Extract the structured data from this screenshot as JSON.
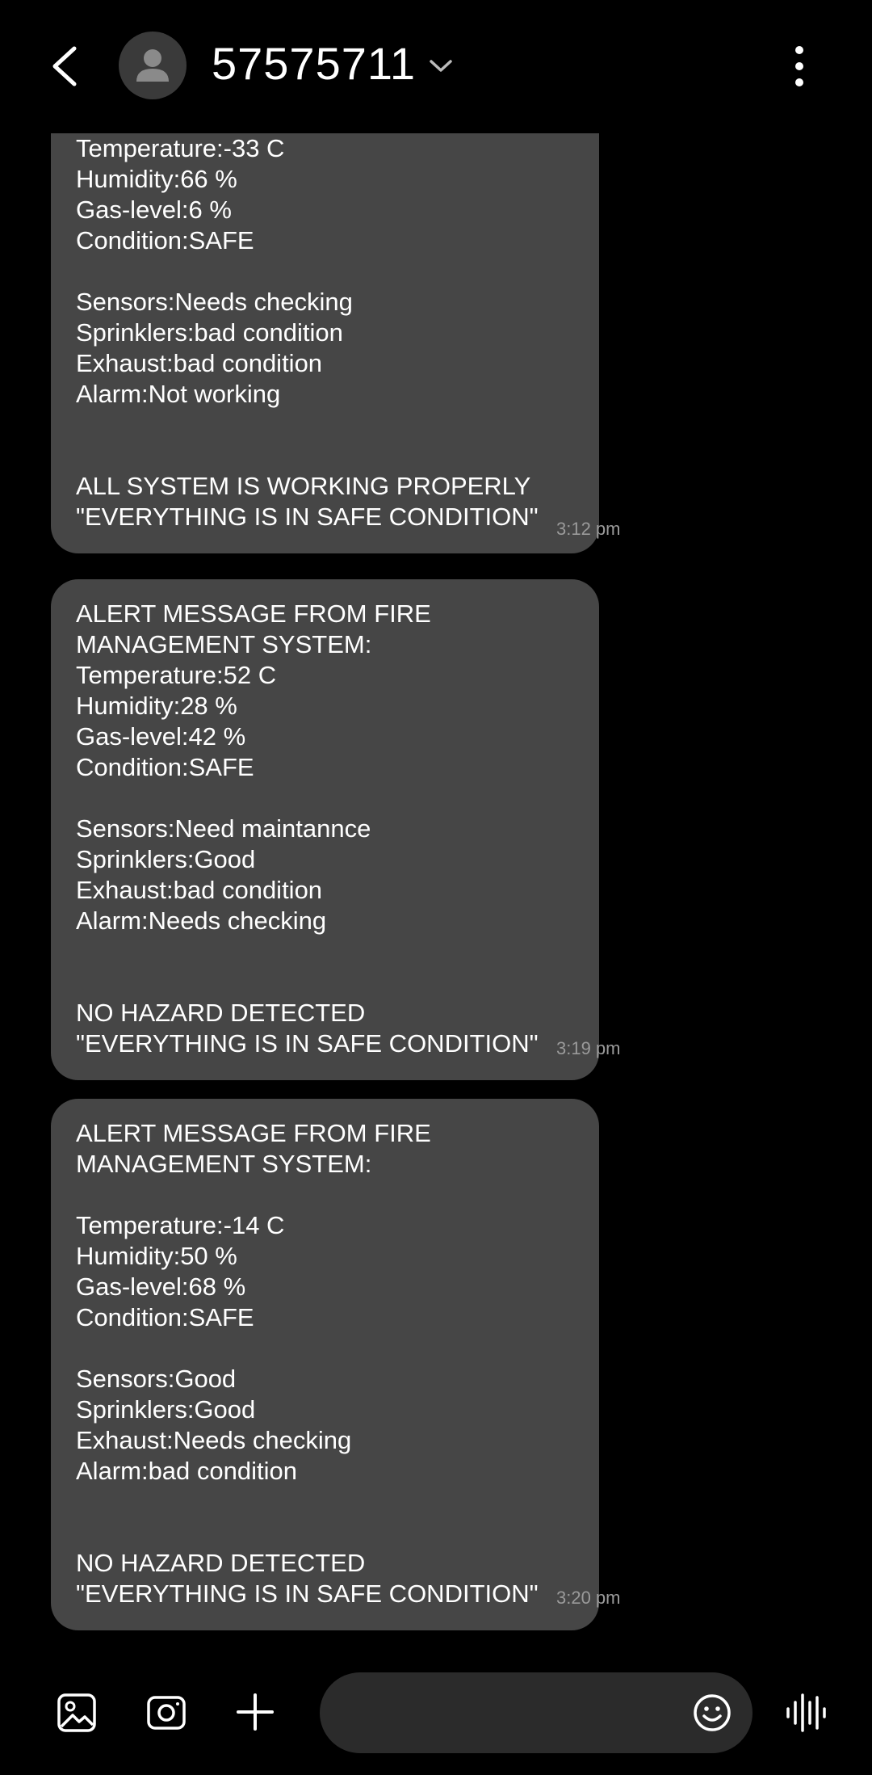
{
  "header": {
    "title": "57575711",
    "icons": {
      "back": "back-arrow-icon",
      "avatar": "contact-avatar",
      "dropdown": "chevron-down-icon",
      "more": "more-vertical-icon"
    }
  },
  "messages": [
    {
      "lines": [
        "Temperature:-33 C",
        "Humidity:66 %",
        "Gas-level:6 %",
        "Condition:SAFE",
        "",
        "Sensors:Needs checking",
        "Sprinklers:bad condition",
        "Exhaust:bad condition",
        "Alarm:Not working",
        "",
        "",
        "ALL SYSTEM IS WORKING PROPERLY",
        "\"EVERYTHING IS IN SAFE CONDITION\""
      ],
      "time": "3:12 pm"
    },
    {
      "lines": [
        "ALERT MESSAGE FROM FIRE",
        "MANAGEMENT SYSTEM:",
        "Temperature:52 C",
        "Humidity:28 %",
        "Gas-level:42 %",
        "Condition:SAFE",
        "",
        "Sensors:Need maintannce",
        "Sprinklers:Good",
        "Exhaust:bad condition",
        "Alarm:Needs checking",
        "",
        "",
        "NO HAZARD DETECTED",
        "\"EVERYTHING IS IN SAFE CONDITION\""
      ],
      "time": "3:19 pm"
    },
    {
      "lines": [
        "ALERT MESSAGE FROM FIRE",
        "MANAGEMENT SYSTEM:",
        "",
        "Temperature:-14 C",
        "Humidity:50 %",
        "Gas-level:68 %",
        "Condition:SAFE",
        "",
        "Sensors:Good",
        "Sprinklers:Good",
        "Exhaust:Needs checking",
        "Alarm:bad condition",
        "",
        "",
        "NO HAZARD DETECTED",
        "\"EVERYTHING IS IN SAFE CONDITION\""
      ],
      "time": "3:20 pm"
    }
  ],
  "composer": {
    "input_value": "",
    "icons": {
      "gallery": "gallery-icon",
      "camera": "camera-icon",
      "attach": "plus-icon",
      "emoji": "emoji-icon",
      "voice": "voice-waveform-icon"
    }
  },
  "colors": {
    "background": "#000000",
    "bubble": "#464646",
    "input": "#2b2b2b",
    "timestamp": "#9a9a9a"
  }
}
